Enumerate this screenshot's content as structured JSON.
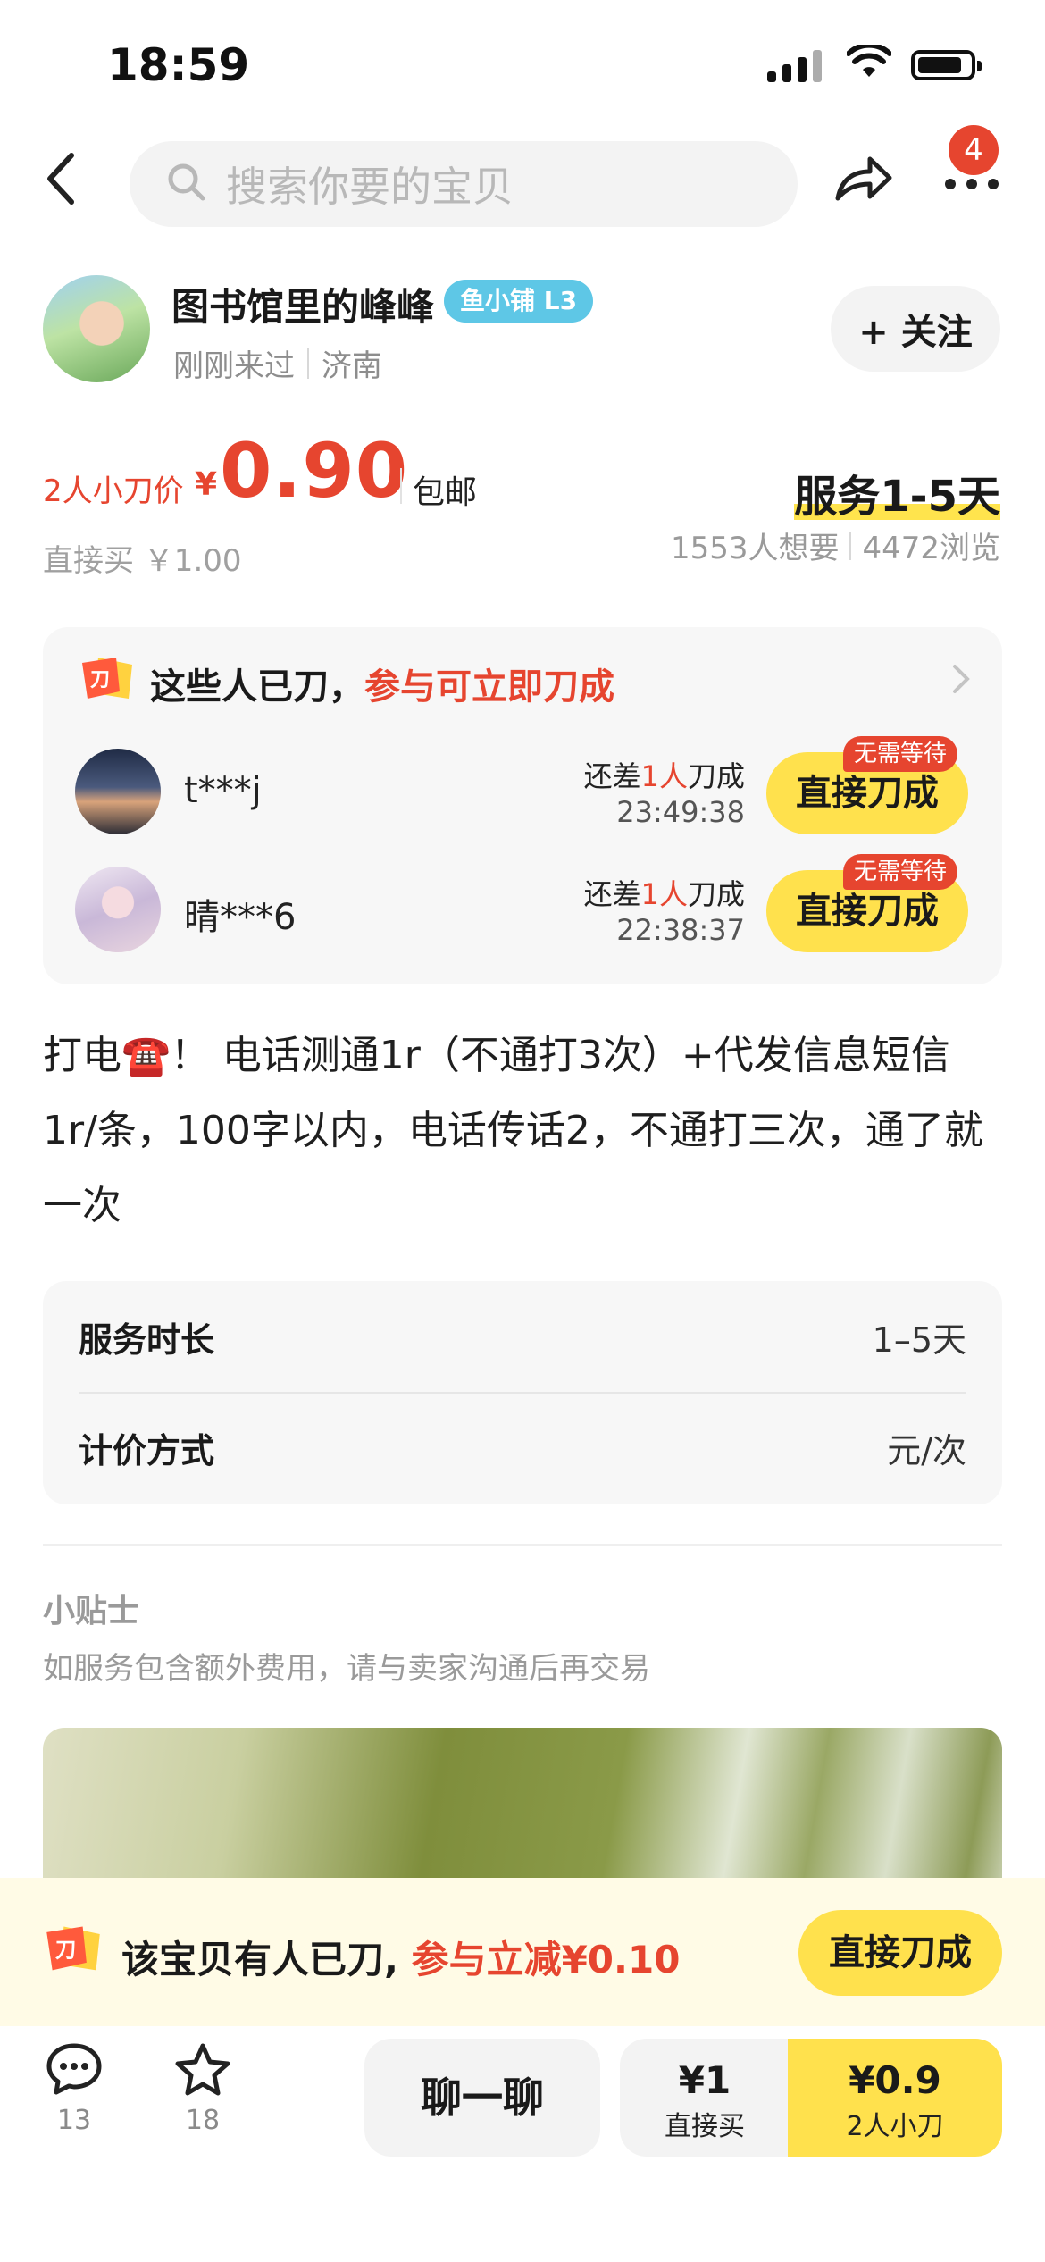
{
  "status_bar": {
    "time": "18:59"
  },
  "nav": {
    "search_placeholder": "搜索你要的宝贝",
    "badge_count": "4"
  },
  "seller": {
    "name": "图书馆里的峰峰",
    "badge": "鱼小铺 L3",
    "last_seen": "刚刚来过",
    "location": "济南",
    "follow_label": "+ 关注"
  },
  "price": {
    "kan_label": "2人小刀价",
    "currency": "¥",
    "kan_price": "0.90",
    "shipping": "包邮",
    "direct_buy": "直接买 ￥1.00",
    "service_days": "服务1-5天",
    "wants": "1553人想要",
    "views": "4472浏览"
  },
  "kan_panel": {
    "title_a": "这些人已刀，",
    "title_b": "参与可立即刀成",
    "users": [
      {
        "name": "t***j",
        "remain_a": "还差",
        "remain_hl": "1人",
        "remain_b": "刀成",
        "timer": "23:49:38",
        "tag": "无需等待",
        "button": "直接刀成"
      },
      {
        "name": "晴***6",
        "remain_a": "还差",
        "remain_hl": "1人",
        "remain_b": "刀成",
        "timer": "22:38:37",
        "tag": "无需等待",
        "button": "直接刀成"
      }
    ]
  },
  "description": "打电☎️！ 电话测通1r（不通打3次）+代发信息短信1r/条，100字以内，电话传话2，不通打三次，通了就一次",
  "info": [
    {
      "key": "服务时长",
      "value": "1–5天"
    },
    {
      "key": "计价方式",
      "value": "元/次"
    }
  ],
  "tips": {
    "title": "小贴士",
    "text": "如服务包含额外费用，请与卖家沟通后再交易"
  },
  "banner": {
    "text_a": "该宝贝有人已刀, ",
    "text_b": "参与立减¥0.10",
    "button": "直接刀成"
  },
  "bottom_bar": {
    "comments": "13",
    "favorites": "18",
    "chat": "聊一聊",
    "direct_price": "¥1",
    "direct_label": "直接买",
    "kan_price": "¥0.9",
    "kan_label": "2人小刀"
  },
  "colors": {
    "accent_red": "#e6452f",
    "accent_yellow": "#ffe14d"
  }
}
